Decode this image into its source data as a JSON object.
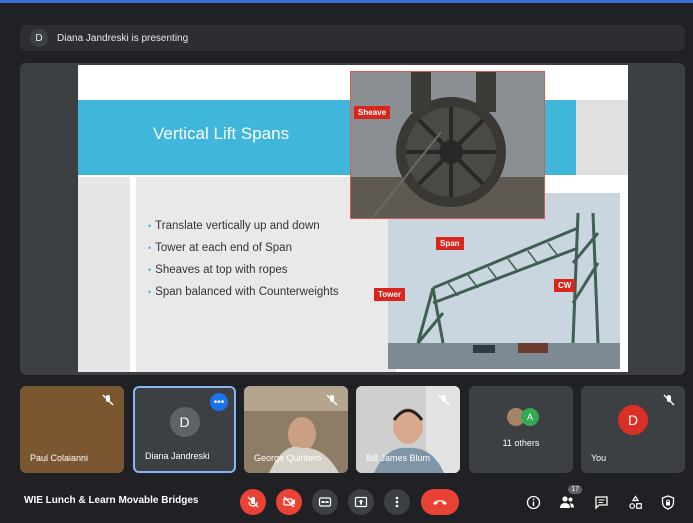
{
  "banner": {
    "avatar_initial": "D",
    "text": "Diana Jandreski is presenting"
  },
  "slide": {
    "title": "Vertical Lift Spans",
    "bullets": [
      "Translate vertically up and down",
      "Tower at each end of Span",
      "Sheaves at top with ropes",
      "Span balanced with Counterweights"
    ],
    "labels": {
      "sheave": "Sheave",
      "span": "Span",
      "tower": "Tower",
      "cw": "CW"
    }
  },
  "participants": {
    "paul": {
      "name": "Paul Colaianni"
    },
    "diana": {
      "name": "Diana Jandreski",
      "initial": "D"
    },
    "george": {
      "name": "George Quintero"
    },
    "james": {
      "name": "Bill James Blum"
    },
    "others": {
      "label": "11 others",
      "initial": "A"
    },
    "you": {
      "name": "You",
      "initial": "D"
    }
  },
  "bottom_bar": {
    "meeting_title": "WIE Lunch & Learn Movable Bridges",
    "people_count": "17"
  },
  "colors": {
    "accent": "#1a73e8",
    "danger": "#ea4335",
    "tile": "#3c4043",
    "slide_band": "#3fb6da"
  }
}
